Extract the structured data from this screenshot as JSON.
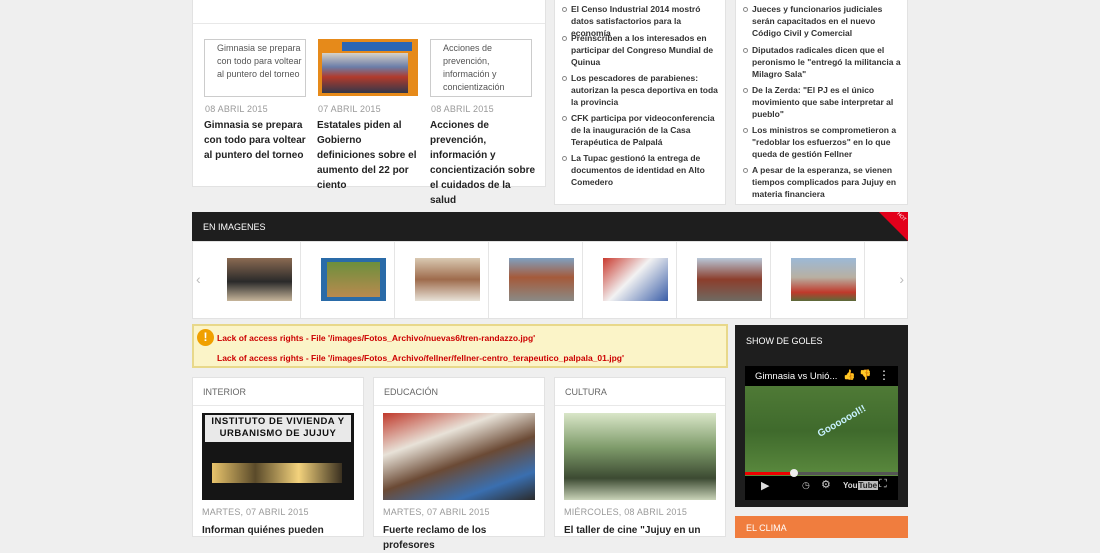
{
  "top_news": [
    {
      "thumb_alt": "Gimnasia se prepara con todo para voltear al puntero del torneo",
      "date": "08 ABRIL 2015",
      "title": "Gimnasia se prepara con todo para voltear al puntero del torneo"
    },
    {
      "thumb_alt": "",
      "date": "07 ABRIL 2015",
      "title": "Estatales piden al Gobierno definiciones sobre el aumento del 22 por ciento"
    },
    {
      "thumb_alt": "Acciones de prevención, información y concientización sobre",
      "date": "08 ABRIL 2015",
      "title": "Acciones de prevención, información y concientización sobre el cuidados de la salud"
    }
  ],
  "list_mid": [
    "El Censo Industrial 2014 mostró datos satisfactorios para la economía",
    "Preinscriben a los interesados en participar del Congreso Mundial de Quinua",
    "Los pescadores de parabienes: autorizan la pesca deportiva en toda la provincia",
    "CFK participa por videoconferencia de la inauguración de la Casa Terapéutica de Palpalá",
    "La Tupac gestionó la entrega de documentos de identidad en Alto Comedero"
  ],
  "list_right": [
    "Jueces y funcionarios judiciales serán capacitados en el nuevo Código Civil y Comercial",
    "Diputados radicales dicen que el peronismo le \"entregó la militancia a Milagro Sala\"",
    "De la Zerda: \"El PJ es el único movimiento que sabe interpretar al pueblo\"",
    "Los ministros se comprometieron a \"redoblar los esfuerzos\" en lo que queda de gestión Fellner",
    "A pesar de la esperanza, se vienen tiempos complicados para Jujuy en materia financiera"
  ],
  "images_section": {
    "title": "EN IMAGENES",
    "hot": "HOT"
  },
  "warnings": [
    "Lack of access rights - File '/images/Fotos_Archivo/nuevas6/tren-randazzo.jpg'",
    "Lack of access rights - File '/images/Fotos_Archivo/fellner/fellner-centro_terapeutico_palpala_01.jpg'"
  ],
  "sections": [
    {
      "name": "INTERIOR",
      "img_text": "INSTITUTO DE VIVIENDA Y URBANISMO DE JUJUY",
      "date": "MARTES, 07 ABRIL 2015",
      "title": "Informan quiénes pueden"
    },
    {
      "name": "EDUCACIÓN",
      "date": "MARTES, 07 ABRIL 2015",
      "title": "Fuerte reclamo de los profesores"
    },
    {
      "name": "CULTURA",
      "date": "MIÉRCOLES, 08 ABRIL 2015",
      "title": "El taller de cine \"Jujuy en un"
    }
  ],
  "goles": {
    "title": "SHOW DE GOLES",
    "video_title": "Gimnasia vs Unió...",
    "overlay": "Gooooool!!"
  },
  "clima": {
    "title": "EL CLIMA"
  }
}
